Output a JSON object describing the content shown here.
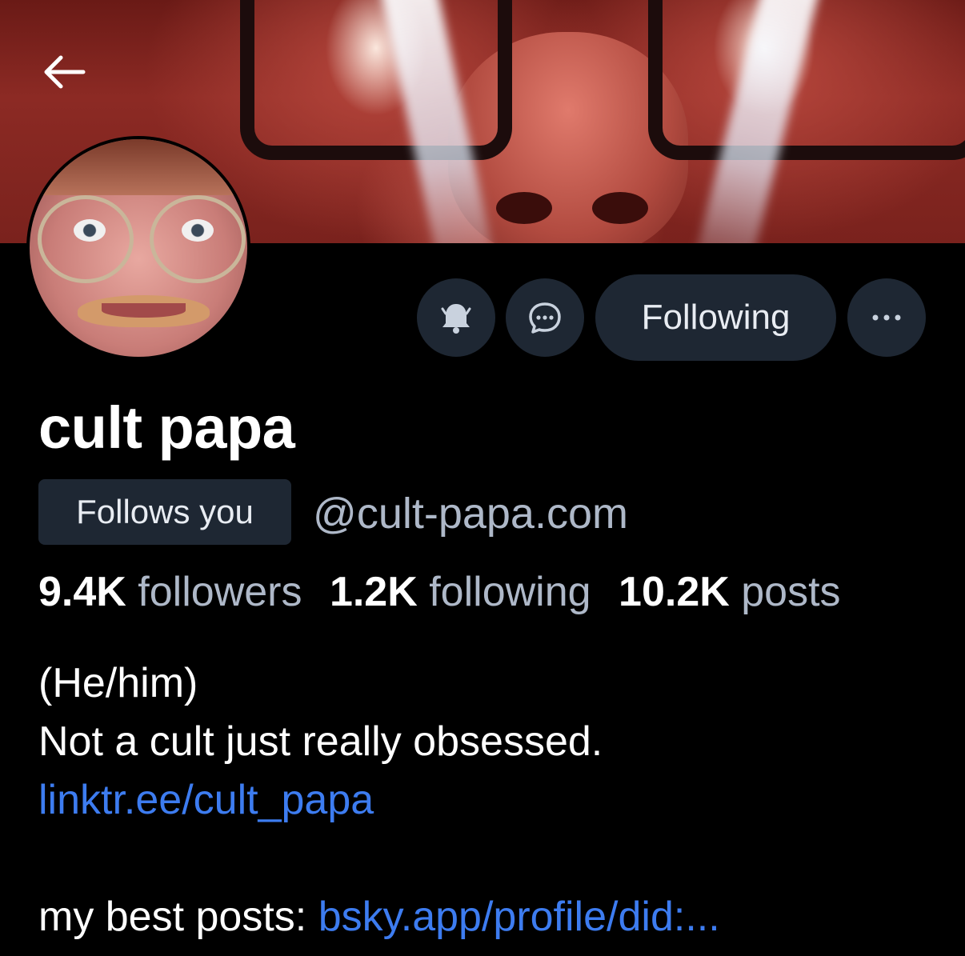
{
  "header": {
    "back_icon": "arrow-left-icon"
  },
  "profile": {
    "display_name": "cult papa",
    "follows_you_badge": "Follows you",
    "handle": "@cult-papa.com"
  },
  "actions": {
    "notify_icon": "bell-icon",
    "message_icon": "chat-bubble-icon",
    "following_label": "Following",
    "more_icon": "ellipsis-icon"
  },
  "stats": {
    "followers_count": "9.4K",
    "followers_label": "followers",
    "following_count": "1.2K",
    "following_label": "following",
    "posts_count": "10.2K",
    "posts_label": "posts"
  },
  "bio": {
    "pronouns": "(He/him)",
    "tagline": "Not a cult just really obsessed.",
    "link": "linktr.ee/cult_papa",
    "best_posts_label": "my best posts:",
    "best_posts_link": "bsky.app/profile/did:..."
  },
  "colors": {
    "background": "#000000",
    "button_bg": "#1e2733",
    "secondary_text": "#aeb8c8",
    "link": "#3d7cf0"
  }
}
